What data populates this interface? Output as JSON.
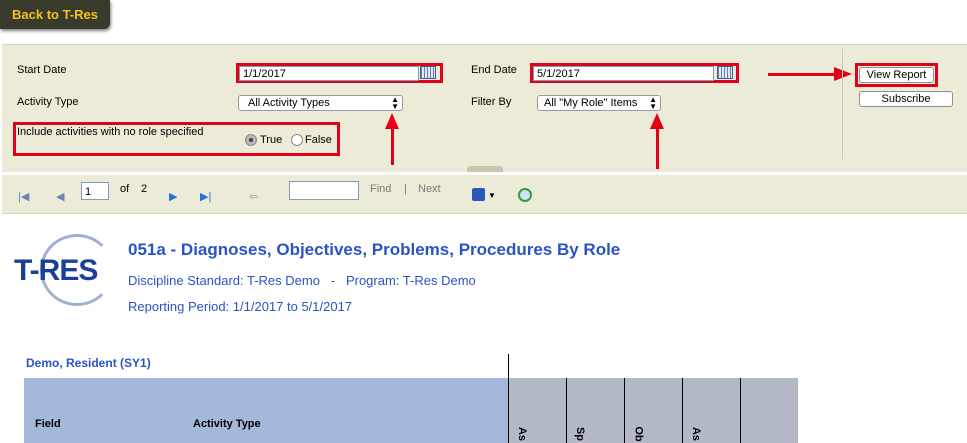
{
  "back_button": {
    "label": "Back to T-Res"
  },
  "params": {
    "start_date": {
      "label": "Start Date",
      "value": "1/1/2017"
    },
    "end_date": {
      "label": "End Date",
      "value": "5/1/2017"
    },
    "activity_type": {
      "label": "Activity Type",
      "value": "All Activity Types"
    },
    "filter_by": {
      "label": "Filter By",
      "value": "All \"My Role\" Items"
    },
    "include_no_role": {
      "label": "Include activities with no role specified",
      "options": [
        "True",
        "False"
      ],
      "selected": "True"
    },
    "view_report": "View Report",
    "subscribe": "Subscribe"
  },
  "toolbar": {
    "page_value": "1",
    "of_label": "of",
    "page_total": "2",
    "find_label": "Find",
    "separator": "|",
    "next_label": "Next"
  },
  "report": {
    "logo_text": "T-RES",
    "title": "051a - Diagnoses, Objectives, Problems, Procedures By Role",
    "discipline": "Discipline Standard: T-Res Demo   -   Program: T-Res Demo",
    "period": "Reporting Period: 1/1/2017 to 5/1/2017",
    "resident": "Demo, Resident (SY1)",
    "columns": {
      "field": "Field",
      "activity_type": "Activity Type"
    },
    "rotated_headers": [
      "As",
      "Sp",
      "Ob",
      "As",
      ""
    ]
  },
  "colors": {
    "annotation_red": "#e3001b",
    "report_blue": "#2a53c6",
    "back_text": "#f0c419"
  }
}
